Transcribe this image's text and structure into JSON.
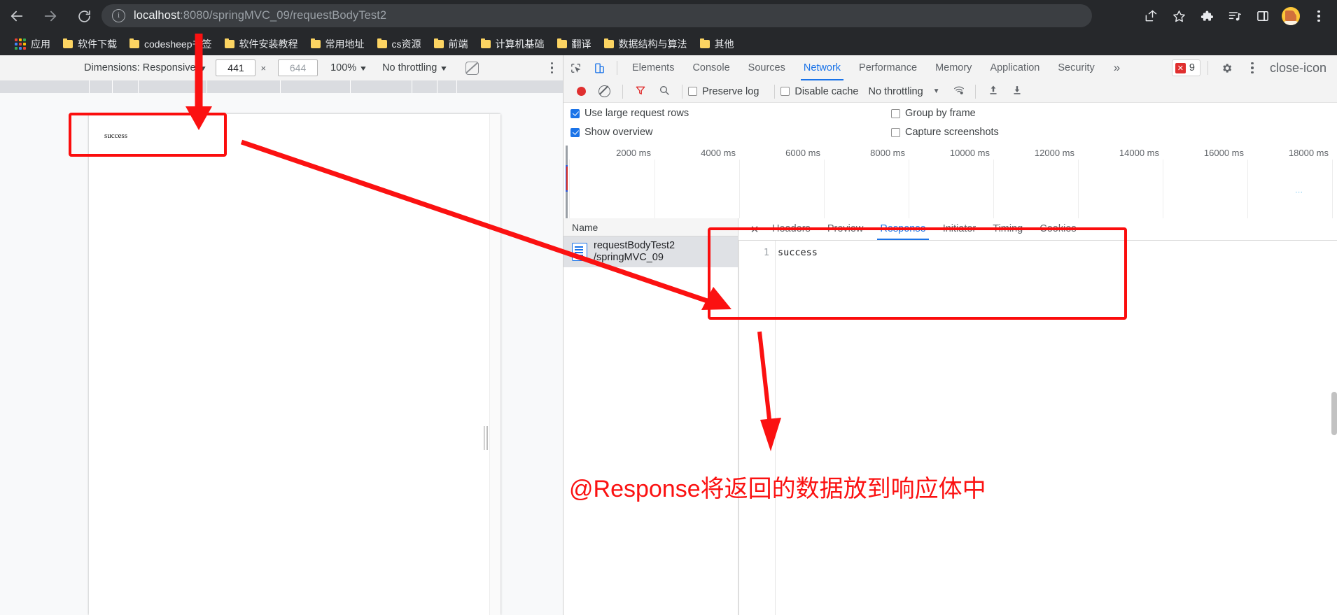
{
  "browser": {
    "url_host": "localhost",
    "url_rest": ":8080/springMVC_09/requestBodyTest2",
    "nav": {
      "back": "back-arrow",
      "forward": "forward-arrow",
      "reload": "reload"
    },
    "toolbar_icons": [
      "share-icon",
      "bookmark-star-icon",
      "extensions-puzzle-icon",
      "reading-list-icon",
      "side-panel-icon",
      "profile-avatar",
      "chrome-menu-icon"
    ],
    "bookmarks": [
      {
        "label": "应用",
        "icon": "apps-grid-icon"
      },
      {
        "label": "软件下载",
        "icon": "folder-icon"
      },
      {
        "label": "codesheep书签",
        "icon": "folder-icon"
      },
      {
        "label": "软件安装教程",
        "icon": "folder-icon"
      },
      {
        "label": "常用地址",
        "icon": "folder-icon"
      },
      {
        "label": "cs资源",
        "icon": "folder-icon"
      },
      {
        "label": "前端",
        "icon": "folder-icon"
      },
      {
        "label": "计算机基础",
        "icon": "folder-icon"
      },
      {
        "label": "翻译",
        "icon": "folder-icon"
      },
      {
        "label": "数据结构与算法",
        "icon": "folder-icon"
      },
      {
        "label": "其他",
        "icon": "folder-icon"
      }
    ]
  },
  "device_toolbar": {
    "dimensions_label": "Dimensions: Responsive",
    "width_value": "441",
    "height_placeholder": "644",
    "zoom": "100%",
    "throttling": "No throttling",
    "rotate_icon": "rotate-device-icon",
    "menu_icon": "kebab-menu-icon"
  },
  "page": {
    "body_text": "success"
  },
  "devtools": {
    "inspect_icon": "inspect-element-icon",
    "device_icon": "toggle-device-toolbar-icon",
    "tabs": [
      {
        "label": "Elements",
        "active": false
      },
      {
        "label": "Console",
        "active": false
      },
      {
        "label": "Sources",
        "active": false
      },
      {
        "label": "Network",
        "active": true
      },
      {
        "label": "Performance",
        "active": false
      },
      {
        "label": "Memory",
        "active": false
      },
      {
        "label": "Application",
        "active": false
      },
      {
        "label": "Security",
        "active": false
      }
    ],
    "more_tabs": "»",
    "error_count": "9",
    "settings_icon": "gear-icon",
    "main_menu_icon": "kebab-menu-icon",
    "close_icon": "close-icon",
    "network_toolbar": {
      "record_icon": "record-button",
      "clear_icon": "clear-icon",
      "filter_icon": "filter-funnel-icon",
      "search_icon": "search-icon",
      "preserve_log": "Preserve log",
      "preserve_log_checked": false,
      "disable_cache": "Disable cache",
      "disable_cache_checked": false,
      "throttling": "No throttling",
      "wifi_icon": "network-conditions-icon",
      "import_icon": "import-har-icon",
      "export_icon": "export-har-icon"
    },
    "options": [
      {
        "label": "Use large request rows",
        "checked": true
      },
      {
        "label": "Group by frame",
        "checked": false
      },
      {
        "label": "Show overview",
        "checked": true
      },
      {
        "label": "Capture screenshots",
        "checked": false
      }
    ],
    "overview_ticks": [
      "2000 ms",
      "4000 ms",
      "6000 ms",
      "8000 ms",
      "10000 ms",
      "12000 ms",
      "14000 ms",
      "16000 ms",
      "18000 ms"
    ],
    "requests_header": "Name",
    "requests": [
      {
        "name": "requestBodyTest2",
        "path": "/springMVC_09",
        "icon": "document-icon",
        "selected": true
      }
    ],
    "detail_tabs": [
      {
        "label": "Headers",
        "active": false
      },
      {
        "label": "Preview",
        "active": false
      },
      {
        "label": "Response",
        "active": true
      },
      {
        "label": "Initiator",
        "active": false
      },
      {
        "label": "Timing",
        "active": false
      },
      {
        "label": "Cookies",
        "active": false
      }
    ],
    "detail_close": "✕",
    "response": {
      "line_number": "1",
      "line_text": "success"
    }
  },
  "annotations": {
    "caption": "@Response将返回的数据放到响应体中",
    "color": "#fb1111"
  }
}
